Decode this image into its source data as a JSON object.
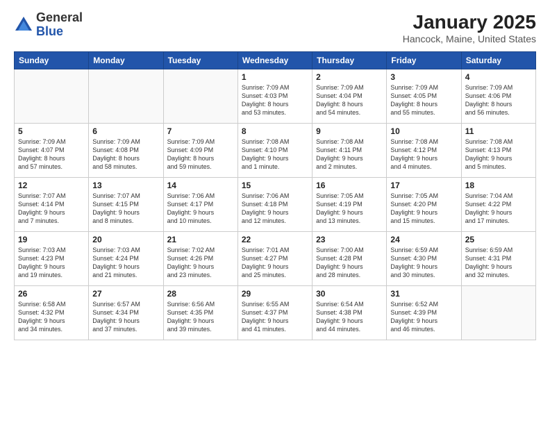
{
  "logo": {
    "general": "General",
    "blue": "Blue"
  },
  "title": "January 2025",
  "subtitle": "Hancock, Maine, United States",
  "days_of_week": [
    "Sunday",
    "Monday",
    "Tuesday",
    "Wednesday",
    "Thursday",
    "Friday",
    "Saturday"
  ],
  "weeks": [
    [
      {
        "day": "",
        "info": ""
      },
      {
        "day": "",
        "info": ""
      },
      {
        "day": "",
        "info": ""
      },
      {
        "day": "1",
        "info": "Sunrise: 7:09 AM\nSunset: 4:03 PM\nDaylight: 8 hours\nand 53 minutes."
      },
      {
        "day": "2",
        "info": "Sunrise: 7:09 AM\nSunset: 4:04 PM\nDaylight: 8 hours\nand 54 minutes."
      },
      {
        "day": "3",
        "info": "Sunrise: 7:09 AM\nSunset: 4:05 PM\nDaylight: 8 hours\nand 55 minutes."
      },
      {
        "day": "4",
        "info": "Sunrise: 7:09 AM\nSunset: 4:06 PM\nDaylight: 8 hours\nand 56 minutes."
      }
    ],
    [
      {
        "day": "5",
        "info": "Sunrise: 7:09 AM\nSunset: 4:07 PM\nDaylight: 8 hours\nand 57 minutes."
      },
      {
        "day": "6",
        "info": "Sunrise: 7:09 AM\nSunset: 4:08 PM\nDaylight: 8 hours\nand 58 minutes."
      },
      {
        "day": "7",
        "info": "Sunrise: 7:09 AM\nSunset: 4:09 PM\nDaylight: 8 hours\nand 59 minutes."
      },
      {
        "day": "8",
        "info": "Sunrise: 7:08 AM\nSunset: 4:10 PM\nDaylight: 9 hours\nand 1 minute."
      },
      {
        "day": "9",
        "info": "Sunrise: 7:08 AM\nSunset: 4:11 PM\nDaylight: 9 hours\nand 2 minutes."
      },
      {
        "day": "10",
        "info": "Sunrise: 7:08 AM\nSunset: 4:12 PM\nDaylight: 9 hours\nand 4 minutes."
      },
      {
        "day": "11",
        "info": "Sunrise: 7:08 AM\nSunset: 4:13 PM\nDaylight: 9 hours\nand 5 minutes."
      }
    ],
    [
      {
        "day": "12",
        "info": "Sunrise: 7:07 AM\nSunset: 4:14 PM\nDaylight: 9 hours\nand 7 minutes."
      },
      {
        "day": "13",
        "info": "Sunrise: 7:07 AM\nSunset: 4:15 PM\nDaylight: 9 hours\nand 8 minutes."
      },
      {
        "day": "14",
        "info": "Sunrise: 7:06 AM\nSunset: 4:17 PM\nDaylight: 9 hours\nand 10 minutes."
      },
      {
        "day": "15",
        "info": "Sunrise: 7:06 AM\nSunset: 4:18 PM\nDaylight: 9 hours\nand 12 minutes."
      },
      {
        "day": "16",
        "info": "Sunrise: 7:05 AM\nSunset: 4:19 PM\nDaylight: 9 hours\nand 13 minutes."
      },
      {
        "day": "17",
        "info": "Sunrise: 7:05 AM\nSunset: 4:20 PM\nDaylight: 9 hours\nand 15 minutes."
      },
      {
        "day": "18",
        "info": "Sunrise: 7:04 AM\nSunset: 4:22 PM\nDaylight: 9 hours\nand 17 minutes."
      }
    ],
    [
      {
        "day": "19",
        "info": "Sunrise: 7:03 AM\nSunset: 4:23 PM\nDaylight: 9 hours\nand 19 minutes."
      },
      {
        "day": "20",
        "info": "Sunrise: 7:03 AM\nSunset: 4:24 PM\nDaylight: 9 hours\nand 21 minutes."
      },
      {
        "day": "21",
        "info": "Sunrise: 7:02 AM\nSunset: 4:26 PM\nDaylight: 9 hours\nand 23 minutes."
      },
      {
        "day": "22",
        "info": "Sunrise: 7:01 AM\nSunset: 4:27 PM\nDaylight: 9 hours\nand 25 minutes."
      },
      {
        "day": "23",
        "info": "Sunrise: 7:00 AM\nSunset: 4:28 PM\nDaylight: 9 hours\nand 28 minutes."
      },
      {
        "day": "24",
        "info": "Sunrise: 6:59 AM\nSunset: 4:30 PM\nDaylight: 9 hours\nand 30 minutes."
      },
      {
        "day": "25",
        "info": "Sunrise: 6:59 AM\nSunset: 4:31 PM\nDaylight: 9 hours\nand 32 minutes."
      }
    ],
    [
      {
        "day": "26",
        "info": "Sunrise: 6:58 AM\nSunset: 4:32 PM\nDaylight: 9 hours\nand 34 minutes."
      },
      {
        "day": "27",
        "info": "Sunrise: 6:57 AM\nSunset: 4:34 PM\nDaylight: 9 hours\nand 37 minutes."
      },
      {
        "day": "28",
        "info": "Sunrise: 6:56 AM\nSunset: 4:35 PM\nDaylight: 9 hours\nand 39 minutes."
      },
      {
        "day": "29",
        "info": "Sunrise: 6:55 AM\nSunset: 4:37 PM\nDaylight: 9 hours\nand 41 minutes."
      },
      {
        "day": "30",
        "info": "Sunrise: 6:54 AM\nSunset: 4:38 PM\nDaylight: 9 hours\nand 44 minutes."
      },
      {
        "day": "31",
        "info": "Sunrise: 6:52 AM\nSunset: 4:39 PM\nDaylight: 9 hours\nand 46 minutes."
      },
      {
        "day": "",
        "info": ""
      }
    ]
  ]
}
